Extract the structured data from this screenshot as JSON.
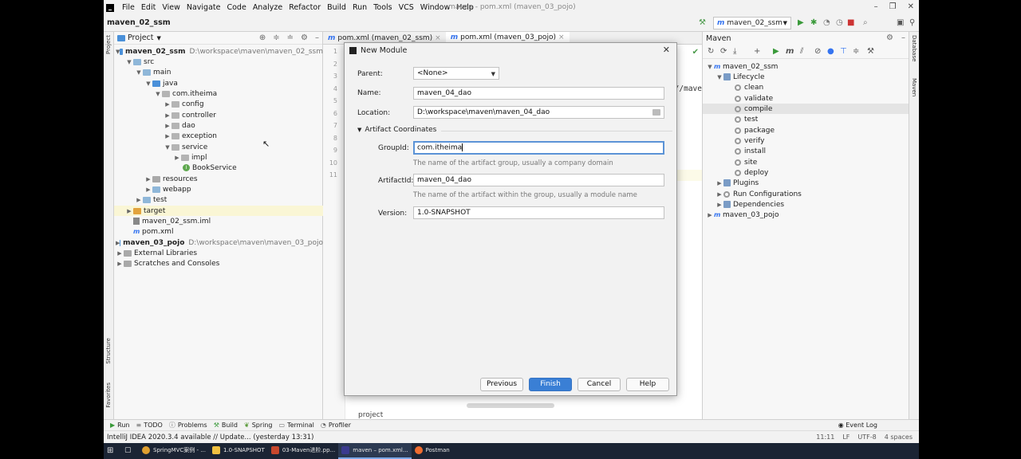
{
  "menubar": {
    "items": [
      "File",
      "Edit",
      "View",
      "Navigate",
      "Code",
      "Analyze",
      "Refactor",
      "Build",
      "Run",
      "Tools",
      "VCS",
      "Window",
      "Help"
    ],
    "window_title": "maven - pom.xml (maven_03_pojo)"
  },
  "navbar": {
    "project": "maven_02_ssm",
    "run_config": "maven_02_ssm"
  },
  "project_panel": {
    "title": "Project",
    "tree": [
      {
        "label": "maven_02_ssm",
        "path": "D:\\workspace\\maven\\maven_02_ssm",
        "bold": true
      },
      {
        "label": "src"
      },
      {
        "label": "main"
      },
      {
        "label": "java"
      },
      {
        "label": "com.itheima"
      },
      {
        "label": "config"
      },
      {
        "label": "controller"
      },
      {
        "label": "dao"
      },
      {
        "label": "exception"
      },
      {
        "label": "service"
      },
      {
        "label": "impl"
      },
      {
        "label": "BookService"
      },
      {
        "label": "resources"
      },
      {
        "label": "webapp"
      },
      {
        "label": "test"
      },
      {
        "label": "target"
      },
      {
        "label": "maven_02_ssm.iml"
      },
      {
        "label": "pom.xml"
      },
      {
        "label": "maven_03_pojo",
        "path": "D:\\workspace\\maven\\maven_03_pojo",
        "bold": true
      },
      {
        "label": "External Libraries"
      },
      {
        "label": "Scratches and Consoles"
      }
    ]
  },
  "editor": {
    "tabs": [
      {
        "label": "pom.xml (maven_02_ssm)"
      },
      {
        "label": "pom.xml (maven_03_pojo)"
      }
    ],
    "line_numbers": [
      "1",
      "2",
      "3",
      "4",
      "5",
      "6",
      "7",
      "8",
      "9",
      "10",
      "11"
    ],
    "fragment": "//mave",
    "breadcrumb": "project"
  },
  "left_strip": {
    "project": "Project",
    "structure": "Structure",
    "favorites": "Favorites"
  },
  "right_strip": {
    "database": "Database",
    "maven": "Maven"
  },
  "maven_panel": {
    "title": "Maven",
    "tree": [
      {
        "label": "maven_02_ssm"
      },
      {
        "label": "Lifecycle"
      },
      {
        "label": "clean"
      },
      {
        "label": "validate"
      },
      {
        "label": "compile"
      },
      {
        "label": "test"
      },
      {
        "label": "package"
      },
      {
        "label": "verify"
      },
      {
        "label": "install"
      },
      {
        "label": "site"
      },
      {
        "label": "deploy"
      },
      {
        "label": "Plugins"
      },
      {
        "label": "Run Configurations"
      },
      {
        "label": "Dependencies"
      },
      {
        "label": "maven_03_pojo"
      }
    ]
  },
  "dialog": {
    "title": "New Module",
    "parent_label": "Parent:",
    "parent_value": "<None>",
    "name_label": "Name:",
    "name_value": "maven_04_dao",
    "location_label": "Location:",
    "location_value": "D:\\workspace\\maven\\maven_04_dao",
    "section": "Artifact Coordinates",
    "groupid_label": "GroupId:",
    "groupid_value": "com.itheima",
    "groupid_hint": "The name of the artifact group, usually a company domain",
    "artifactid_label": "ArtifactId:",
    "artifactid_value": "maven_04_dao",
    "artifactid_hint": "The name of the artifact within the group, usually a module name",
    "version_label": "Version:",
    "version_value": "1.0-SNAPSHOT",
    "buttons": {
      "previous": "Previous",
      "finish": "Finish",
      "cancel": "Cancel",
      "help": "Help"
    }
  },
  "bottom_tools": [
    "Run",
    "TODO",
    "Problems",
    "Build",
    "Spring",
    "Terminal",
    "Profiler"
  ],
  "event_log": "Event Log",
  "status": {
    "message": "IntelliJ IDEA 2020.3.4 available // Update... (yesterday 13:31)",
    "position": "11:11",
    "line_sep": "LF",
    "encoding": "UTF-8",
    "indent": "4 spaces"
  },
  "taskbar": [
    {
      "label": "SpringMVC案例 - ...",
      "color": "#e0a030"
    },
    {
      "label": "1.0-SNAPSHOT",
      "color": "#f0c040"
    },
    {
      "label": "03-Maven进阶.pp...",
      "color": "#c8472c"
    },
    {
      "label": "maven – pom.xml...",
      "color": "#3b3b8f"
    },
    {
      "label": "Postman",
      "color": "#ef6c2f"
    }
  ],
  "colors": {
    "accent": "#3a7fd5",
    "selection": "#e4e4e4",
    "highlight": "#faf6d5"
  }
}
